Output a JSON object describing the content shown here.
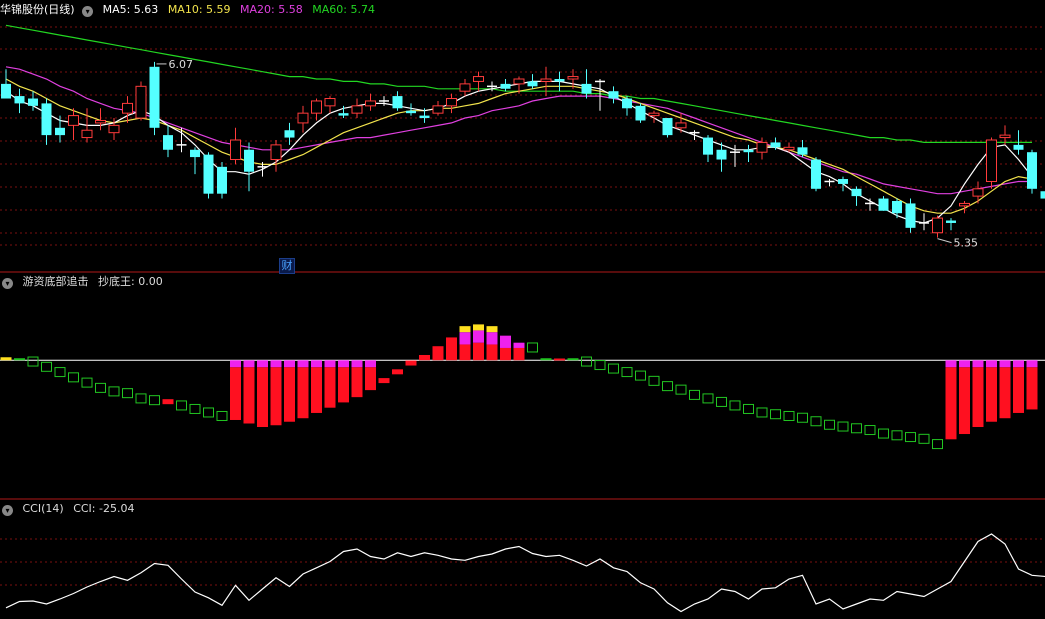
{
  "main": {
    "title": "华锦股份(日线)",
    "ma": [
      {
        "label": "MA5: 5.63",
        "color": "#ffffff"
      },
      {
        "label": "MA10: 5.59",
        "color": "#f2e34c"
      },
      {
        "label": "MA20: 5.58",
        "color": "#e040e0"
      },
      {
        "label": "MA60: 5.74",
        "color": "#22d622"
      }
    ],
    "high_label": "6.07",
    "low_label": "5.35",
    "cai_label": "财"
  },
  "panel2": {
    "title": "游资底部追击",
    "indicator": "抄底王: 0.00"
  },
  "panel3": {
    "title": "CCI(14)",
    "indicator": "CCI: -25.04"
  },
  "chart_data": [
    {
      "type": "candlestick",
      "name": "华锦股份(日线)",
      "ylim": [
        5.25,
        6.25
      ],
      "candles": [
        {
          "o": 5.98,
          "h": 6.04,
          "l": 5.92,
          "c": 5.92
        },
        {
          "o": 5.93,
          "h": 5.96,
          "l": 5.86,
          "c": 5.9
        },
        {
          "o": 5.92,
          "h": 5.95,
          "l": 5.87,
          "c": 5.89
        },
        {
          "o": 5.9,
          "h": 5.92,
          "l": 5.73,
          "c": 5.77
        },
        {
          "o": 5.8,
          "h": 5.85,
          "l": 5.74,
          "c": 5.77
        },
        {
          "o": 5.81,
          "h": 5.88,
          "l": 5.75,
          "c": 5.85
        },
        {
          "o": 5.76,
          "h": 5.88,
          "l": 5.74,
          "c": 5.79
        },
        {
          "o": 5.82,
          "h": 5.88,
          "l": 5.79,
          "c": 5.83
        },
        {
          "o": 5.78,
          "h": 5.84,
          "l": 5.75,
          "c": 5.81
        },
        {
          "o": 5.86,
          "h": 5.93,
          "l": 5.82,
          "c": 5.9
        },
        {
          "o": 5.84,
          "h": 5.99,
          "l": 5.83,
          "c": 5.97
        },
        {
          "o": 6.05,
          "h": 6.07,
          "l": 5.77,
          "c": 5.8
        },
        {
          "o": 5.77,
          "h": 5.81,
          "l": 5.68,
          "c": 5.71
        },
        {
          "o": 5.73,
          "h": 5.8,
          "l": 5.7,
          "c": 5.73
        },
        {
          "o": 5.71,
          "h": 5.72,
          "l": 5.61,
          "c": 5.68
        },
        {
          "o": 5.69,
          "h": 5.7,
          "l": 5.51,
          "c": 5.53
        },
        {
          "o": 5.64,
          "h": 5.66,
          "l": 5.51,
          "c": 5.53
        },
        {
          "o": 5.67,
          "h": 5.8,
          "l": 5.65,
          "c": 5.75
        },
        {
          "o": 5.71,
          "h": 5.74,
          "l": 5.54,
          "c": 5.62
        },
        {
          "o": 5.64,
          "h": 5.66,
          "l": 5.6,
          "c": 5.64
        },
        {
          "o": 5.67,
          "h": 5.75,
          "l": 5.62,
          "c": 5.73
        },
        {
          "o": 5.79,
          "h": 5.82,
          "l": 5.73,
          "c": 5.76
        },
        {
          "o": 5.82,
          "h": 5.89,
          "l": 5.78,
          "c": 5.86
        },
        {
          "o": 5.86,
          "h": 5.92,
          "l": 5.83,
          "c": 5.91
        },
        {
          "o": 5.89,
          "h": 5.93,
          "l": 5.86,
          "c": 5.92
        },
        {
          "o": 5.86,
          "h": 5.89,
          "l": 5.84,
          "c": 5.85
        },
        {
          "o": 5.86,
          "h": 5.92,
          "l": 5.84,
          "c": 5.89
        },
        {
          "o": 5.89,
          "h": 5.94,
          "l": 5.87,
          "c": 5.91
        },
        {
          "o": 5.91,
          "h": 5.93,
          "l": 5.89,
          "c": 5.91
        },
        {
          "o": 5.93,
          "h": 5.95,
          "l": 5.87,
          "c": 5.88
        },
        {
          "o": 5.87,
          "h": 5.9,
          "l": 5.85,
          "c": 5.86
        },
        {
          "o": 5.85,
          "h": 5.88,
          "l": 5.82,
          "c": 5.84
        },
        {
          "o": 5.86,
          "h": 5.91,
          "l": 5.85,
          "c": 5.89
        },
        {
          "o": 5.89,
          "h": 5.94,
          "l": 5.86,
          "c": 5.92
        },
        {
          "o": 5.95,
          "h": 6.0,
          "l": 5.93,
          "c": 5.98
        },
        {
          "o": 5.99,
          "h": 6.03,
          "l": 5.95,
          "c": 6.01
        },
        {
          "o": 5.97,
          "h": 5.99,
          "l": 5.95,
          "c": 5.97
        },
        {
          "o": 5.98,
          "h": 6.0,
          "l": 5.95,
          "c": 5.96
        },
        {
          "o": 5.98,
          "h": 6.01,
          "l": 5.94,
          "c": 6.0
        },
        {
          "o": 5.99,
          "h": 6.02,
          "l": 5.96,
          "c": 5.97
        },
        {
          "o": 5.99,
          "h": 6.05,
          "l": 5.93,
          "c": 6.0
        },
        {
          "o": 6.0,
          "h": 6.03,
          "l": 5.95,
          "c": 5.99
        },
        {
          "o": 6.0,
          "h": 6.04,
          "l": 5.96,
          "c": 6.01
        },
        {
          "o": 5.98,
          "h": 6.04,
          "l": 5.92,
          "c": 5.94
        },
        {
          "o": 5.99,
          "h": 6.0,
          "l": 5.87,
          "c": 5.99
        },
        {
          "o": 5.95,
          "h": 5.97,
          "l": 5.9,
          "c": 5.92
        },
        {
          "o": 5.92,
          "h": 5.93,
          "l": 5.85,
          "c": 5.88
        },
        {
          "o": 5.89,
          "h": 5.9,
          "l": 5.82,
          "c": 5.83
        },
        {
          "o": 5.85,
          "h": 5.87,
          "l": 5.82,
          "c": 5.86
        },
        {
          "o": 5.84,
          "h": 5.84,
          "l": 5.76,
          "c": 5.77
        },
        {
          "o": 5.8,
          "h": 5.86,
          "l": 5.78,
          "c": 5.82
        },
        {
          "o": 5.78,
          "h": 5.79,
          "l": 5.75,
          "c": 5.78
        },
        {
          "o": 5.76,
          "h": 5.77,
          "l": 5.66,
          "c": 5.69
        },
        {
          "o": 5.71,
          "h": 5.74,
          "l": 5.62,
          "c": 5.67
        },
        {
          "o": 5.7,
          "h": 5.73,
          "l": 5.64,
          "c": 5.7
        },
        {
          "o": 5.71,
          "h": 5.73,
          "l": 5.66,
          "c": 5.7
        },
        {
          "o": 5.7,
          "h": 5.76,
          "l": 5.67,
          "c": 5.74
        },
        {
          "o": 5.74,
          "h": 5.76,
          "l": 5.71,
          "c": 5.72
        },
        {
          "o": 5.71,
          "h": 5.74,
          "l": 5.7,
          "c": 5.72
        },
        {
          "o": 5.72,
          "h": 5.75,
          "l": 5.68,
          "c": 5.69
        },
        {
          "o": 5.67,
          "h": 5.68,
          "l": 5.54,
          "c": 5.55
        },
        {
          "o": 5.58,
          "h": 5.59,
          "l": 5.56,
          "c": 5.58
        },
        {
          "o": 5.59,
          "h": 5.6,
          "l": 5.54,
          "c": 5.57
        },
        {
          "o": 5.55,
          "h": 5.56,
          "l": 5.48,
          "c": 5.52
        },
        {
          "o": 5.49,
          "h": 5.51,
          "l": 5.46,
          "c": 5.49
        },
        {
          "o": 5.51,
          "h": 5.52,
          "l": 5.46,
          "c": 5.46
        },
        {
          "o": 5.5,
          "h": 5.51,
          "l": 5.43,
          "c": 5.45
        },
        {
          "o": 5.49,
          "h": 5.51,
          "l": 5.37,
          "c": 5.39
        },
        {
          "o": 5.41,
          "h": 5.45,
          "l": 5.38,
          "c": 5.41
        },
        {
          "o": 5.37,
          "h": 5.44,
          "l": 5.35,
          "c": 5.43
        },
        {
          "o": 5.42,
          "h": 5.43,
          "l": 5.38,
          "c": 5.41
        },
        {
          "o": 5.48,
          "h": 5.5,
          "l": 5.45,
          "c": 5.49
        },
        {
          "o": 5.52,
          "h": 5.58,
          "l": 5.49,
          "c": 5.55
        },
        {
          "o": 5.58,
          "h": 5.76,
          "l": 5.55,
          "c": 5.75
        },
        {
          "o": 5.76,
          "h": 5.81,
          "l": 5.73,
          "c": 5.77
        },
        {
          "o": 5.73,
          "h": 5.79,
          "l": 5.69,
          "c": 5.71
        },
        {
          "o": 5.7,
          "h": 5.71,
          "l": 5.53,
          "c": 5.55
        },
        {
          "o": 5.54,
          "h": 5.56,
          "l": 5.46,
          "c": 5.51
        },
        {
          "o": 5.52,
          "h": 5.55,
          "l": 5.49,
          "c": 5.5
        }
      ],
      "ma5": [
        5.95,
        5.91,
        5.89,
        5.86,
        5.83,
        5.82,
        5.81,
        5.81,
        5.82,
        5.85,
        5.87,
        5.85,
        5.81,
        5.78,
        5.73,
        5.67,
        5.62,
        5.62,
        5.61,
        5.63,
        5.66,
        5.71,
        5.77,
        5.82,
        5.86,
        5.88,
        5.89,
        5.9,
        5.9,
        5.89,
        5.88,
        5.87,
        5.88,
        5.9,
        5.93,
        5.95,
        5.96,
        5.97,
        5.98,
        5.99,
        5.99,
        5.99,
        5.98,
        5.97,
        5.96,
        5.93,
        5.9,
        5.87,
        5.84,
        5.81,
        5.79,
        5.77,
        5.75,
        5.73,
        5.71,
        5.71,
        5.72,
        5.72,
        5.7,
        5.66,
        5.62,
        5.6,
        5.57,
        5.53,
        5.5,
        5.47,
        5.44,
        5.42,
        5.41,
        5.43,
        5.48,
        5.57,
        5.65,
        5.72,
        5.73,
        5.67,
        5.6
      ],
      "ma10": [
        6.0,
        5.97,
        5.95,
        5.92,
        5.89,
        5.87,
        5.85,
        5.83,
        5.82,
        5.83,
        5.84,
        5.83,
        5.81,
        5.79,
        5.76,
        5.73,
        5.7,
        5.68,
        5.66,
        5.65,
        5.65,
        5.67,
        5.69,
        5.72,
        5.75,
        5.78,
        5.8,
        5.82,
        5.84,
        5.86,
        5.87,
        5.87,
        5.88,
        5.88,
        5.89,
        5.9,
        5.92,
        5.94,
        5.95,
        5.96,
        5.97,
        5.97,
        5.97,
        5.96,
        5.95,
        5.94,
        5.92,
        5.9,
        5.88,
        5.86,
        5.84,
        5.82,
        5.8,
        5.78,
        5.76,
        5.75,
        5.73,
        5.72,
        5.71,
        5.69,
        5.67,
        5.65,
        5.63,
        5.6,
        5.57,
        5.54,
        5.51,
        5.48,
        5.46,
        5.45,
        5.45,
        5.47,
        5.5,
        5.54,
        5.58,
        5.6,
        5.59
      ],
      "ma20": [
        6.05,
        6.04,
        6.02,
        6.0,
        5.97,
        5.95,
        5.92,
        5.9,
        5.88,
        5.87,
        5.86,
        5.84,
        5.82,
        5.8,
        5.78,
        5.76,
        5.74,
        5.73,
        5.72,
        5.71,
        5.71,
        5.71,
        5.72,
        5.73,
        5.74,
        5.75,
        5.76,
        5.76,
        5.77,
        5.78,
        5.79,
        5.8,
        5.81,
        5.82,
        5.84,
        5.85,
        5.87,
        5.88,
        5.89,
        5.91,
        5.92,
        5.93,
        5.93,
        5.93,
        5.93,
        5.92,
        5.91,
        5.9,
        5.89,
        5.88,
        5.86,
        5.84,
        5.82,
        5.8,
        5.78,
        5.76,
        5.74,
        5.72,
        5.7,
        5.68,
        5.66,
        5.64,
        5.62,
        5.61,
        5.59,
        5.57,
        5.56,
        5.55,
        5.54,
        5.53,
        5.53,
        5.54,
        5.55,
        5.56,
        5.57,
        5.58,
        5.58
      ],
      "ma60": [
        6.22,
        6.21,
        6.2,
        6.19,
        6.18,
        6.17,
        6.16,
        6.15,
        6.14,
        6.13,
        6.12,
        6.11,
        6.1,
        6.09,
        6.08,
        6.07,
        6.06,
        6.05,
        6.04,
        6.03,
        6.02,
        6.01,
        6.01,
        6.0,
        6.0,
        5.99,
        5.99,
        5.98,
        5.98,
        5.97,
        5.97,
        5.97,
        5.96,
        5.96,
        5.96,
        5.96,
        5.96,
        5.95,
        5.95,
        5.95,
        5.95,
        5.95,
        5.95,
        5.94,
        5.94,
        5.93,
        5.93,
        5.92,
        5.92,
        5.91,
        5.9,
        5.89,
        5.88,
        5.87,
        5.86,
        5.85,
        5.84,
        5.83,
        5.82,
        5.81,
        5.8,
        5.79,
        5.78,
        5.77,
        5.76,
        5.76,
        5.75,
        5.75,
        5.74,
        5.74,
        5.74,
        5.74,
        5.74,
        5.74,
        5.74,
        5.74,
        5.74
      ]
    },
    {
      "type": "bar",
      "name": "游资底部追击",
      "ylim": [
        -0.75,
        0.4
      ],
      "values": [
        0.01,
        -0.01,
        -0.03,
        -0.06,
        -0.09,
        -0.12,
        -0.15,
        -0.18,
        -0.2,
        -0.21,
        -0.24,
        -0.25,
        -0.25,
        -0.28,
        -0.3,
        -0.32,
        -0.34,
        -0.34,
        -0.36,
        -0.38,
        -0.37,
        -0.35,
        -0.33,
        -0.3,
        -0.27,
        -0.24,
        -0.21,
        -0.17,
        -0.13,
        -0.08,
        -0.03,
        0.03,
        0.08,
        0.13,
        0.16,
        0.17,
        0.16,
        0.14,
        0.1,
        0.05,
        0.01,
        0.01,
        -0.01,
        -0.03,
        -0.05,
        -0.07,
        -0.09,
        -0.11,
        -0.14,
        -0.17,
        -0.19,
        -0.22,
        -0.24,
        -0.26,
        -0.28,
        -0.3,
        -0.32,
        -0.33,
        -0.34,
        -0.35,
        -0.37,
        -0.39,
        -0.4,
        -0.41,
        -0.42,
        -0.44,
        -0.45,
        -0.46,
        -0.47,
        -0.5,
        -0.45,
        -0.42,
        -0.38,
        -0.35,
        -0.33,
        -0.3,
        -0.28
      ],
      "tops": [
        null,
        null,
        null,
        null,
        null,
        null,
        null,
        null,
        null,
        null,
        null,
        null,
        null,
        null,
        null,
        null,
        null,
        -0.04,
        -0.04,
        -0.04,
        -0.04,
        -0.04,
        -0.04,
        -0.04,
        -0.04,
        -0.04,
        -0.04,
        -0.04,
        null,
        null,
        null,
        null,
        null,
        null,
        0.09,
        0.1,
        0.09,
        0.07,
        0.07,
        null,
        null,
        null,
        null,
        null,
        null,
        null,
        null,
        null,
        null,
        null,
        null,
        null,
        null,
        null,
        null,
        null,
        null,
        null,
        null,
        null,
        null,
        null,
        null,
        null,
        null,
        null,
        null,
        null,
        null,
        null,
        -0.04,
        -0.04,
        -0.04,
        -0.04,
        -0.04,
        -0.04,
        -0.04
      ]
    },
    {
      "type": "line",
      "name": "CCI(14)",
      "ylim": [
        -200,
        200
      ],
      "values": [
        -175,
        -150,
        -148,
        -160,
        -140,
        -118,
        -92,
        -70,
        -50,
        -65,
        -35,
        2,
        -5,
        -60,
        -112,
        -135,
        -165,
        -85,
        -145,
        -100,
        -55,
        -90,
        -40,
        -15,
        10,
        50,
        60,
        30,
        20,
        45,
        30,
        45,
        35,
        20,
        15,
        30,
        40,
        60,
        70,
        42,
        30,
        35,
        15,
        -8,
        20,
        -15,
        -30,
        -75,
        -100,
        -155,
        -190,
        -160,
        -140,
        -100,
        -110,
        -140,
        -100,
        -95,
        -60,
        -45,
        -160,
        -140,
        -180,
        -160,
        -140,
        -145,
        -110,
        -120,
        -130,
        -100,
        -70,
        10,
        90,
        120,
        80,
        -20,
        -45,
        -50
      ]
    }
  ]
}
